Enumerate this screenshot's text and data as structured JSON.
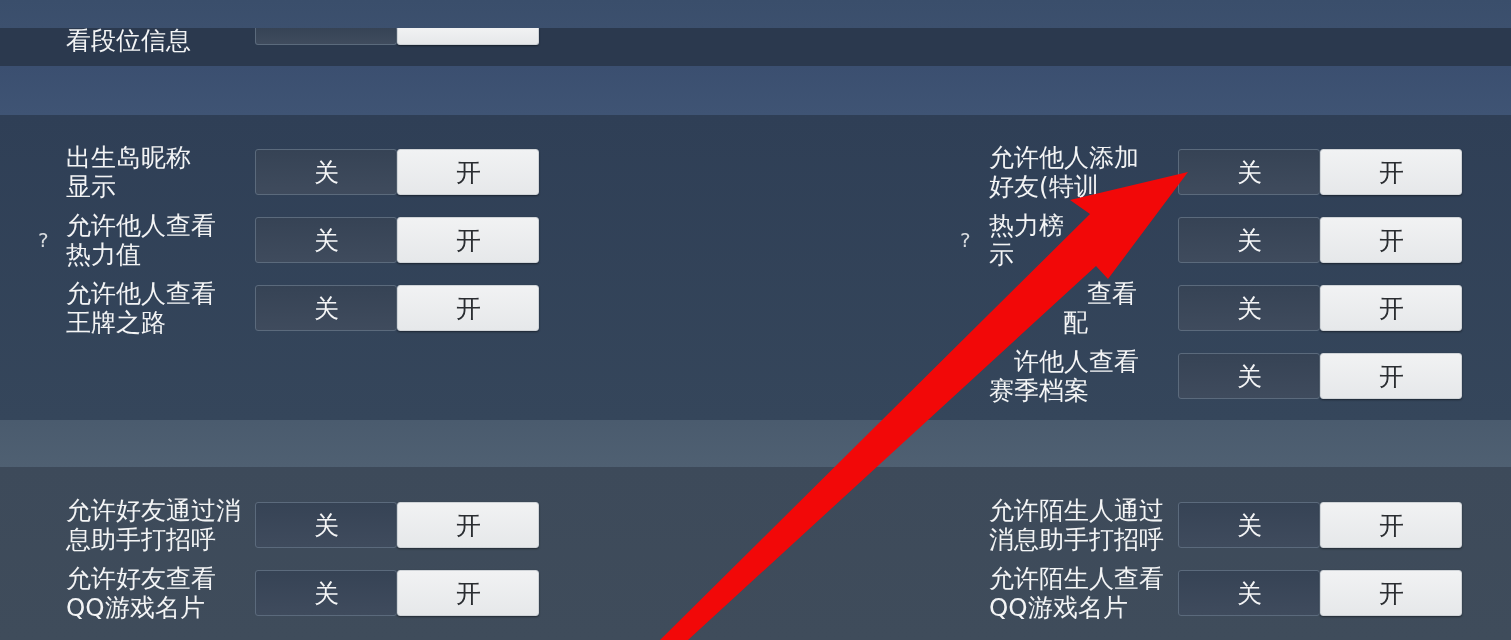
{
  "panels": [
    {
      "cut_top": true,
      "columns": [
        [
          {
            "label_lines": [
              "看段位信息"
            ],
            "options": [
              {
                "selected": false
              },
              {
                "selected": true
              }
            ]
          }
        ]
      ]
    },
    {
      "cut_top": false,
      "columns": [
        [
          {
            "label_lines": [
              "出生岛昵称",
              "显示"
            ],
            "options": [
              {
                "label": "关",
                "selected": false
              },
              {
                "label": "开",
                "selected": true
              }
            ]
          },
          {
            "help": "?",
            "label_lines": [
              "允许他人查看",
              "热力值"
            ],
            "options": [
              {
                "label": "关",
                "selected": false
              },
              {
                "label": "开",
                "selected": true
              }
            ]
          },
          {
            "label_lines": [
              "允许他人查看",
              "王牌之路"
            ],
            "options": [
              {
                "label": "关",
                "selected": false
              },
              {
                "label": "开",
                "selected": true
              }
            ]
          }
        ],
        [
          {
            "label_lines": [
              "允许他人添加",
              [
                {
                  "kind": "text",
                  "text": "好友(特训"
                }
              ]
            ],
            "options": [
              {
                "label": "关",
                "selected": false
              },
              {
                "label": "开",
                "selected": true
              }
            ]
          },
          {
            "help": "?",
            "label_lines": [
              [
                {
                  "kind": "text",
                  "text": "热力榜"
                }
              ],
              "示"
            ],
            "options": [
              {
                "label": "关",
                "selected": false
              },
              {
                "label": "开",
                "selected": true
              }
            ]
          },
          {
            "label_lines": [
              [
                {
                  "kind": "covered"
                },
                {
                  "kind": "covered"
                },
                {
                  "kind": "covered"
                },
                {
                  "kind": "covered"
                },
                {
                  "kind": "text",
                  "text": "查看"
                }
              ],
              [
                {
                  "kind": "covered"
                },
                {
                  "kind": "covered"
                },
                {
                  "kind": "covered"
                },
                {
                  "kind": "text",
                  "text": "配"
                }
              ]
            ],
            "options": [
              {
                "label": "关",
                "selected": false
              },
              {
                "label": "开",
                "selected": true
              }
            ]
          },
          {
            "label_lines": [
              [
                {
                  "kind": "covered"
                },
                {
                  "kind": "text",
                  "text": "许他人查看"
                }
              ],
              "赛季档案"
            ],
            "options": [
              {
                "label": "关",
                "selected": false
              },
              {
                "label": "开",
                "selected": true
              }
            ]
          }
        ]
      ]
    },
    {
      "cut_top": false,
      "columns": [
        [
          {
            "label_lines": [
              "允许好友通过消",
              "息助手打招呼"
            ],
            "options": [
              {
                "label": "关",
                "selected": false
              },
              {
                "label": "开",
                "selected": true
              }
            ]
          },
          {
            "label_lines": [
              "允许好友查看",
              "QQ游戏名片"
            ],
            "options": [
              {
                "label": "关",
                "selected": false
              },
              {
                "label": "开",
                "selected": true
              }
            ]
          }
        ],
        [
          {
            "label_lines": [
              "允许陌生人通过",
              "消息助手打招呼"
            ],
            "options": [
              {
                "label": "关",
                "selected": false
              },
              {
                "label": "开",
                "selected": true
              }
            ]
          },
          {
            "label_lines": [
              "允许陌生人查看",
              "QQ游戏名片"
            ],
            "options": [
              {
                "label": "关",
                "selected": false
              },
              {
                "label": "开",
                "selected": true
              }
            ]
          }
        ]
      ]
    }
  ]
}
